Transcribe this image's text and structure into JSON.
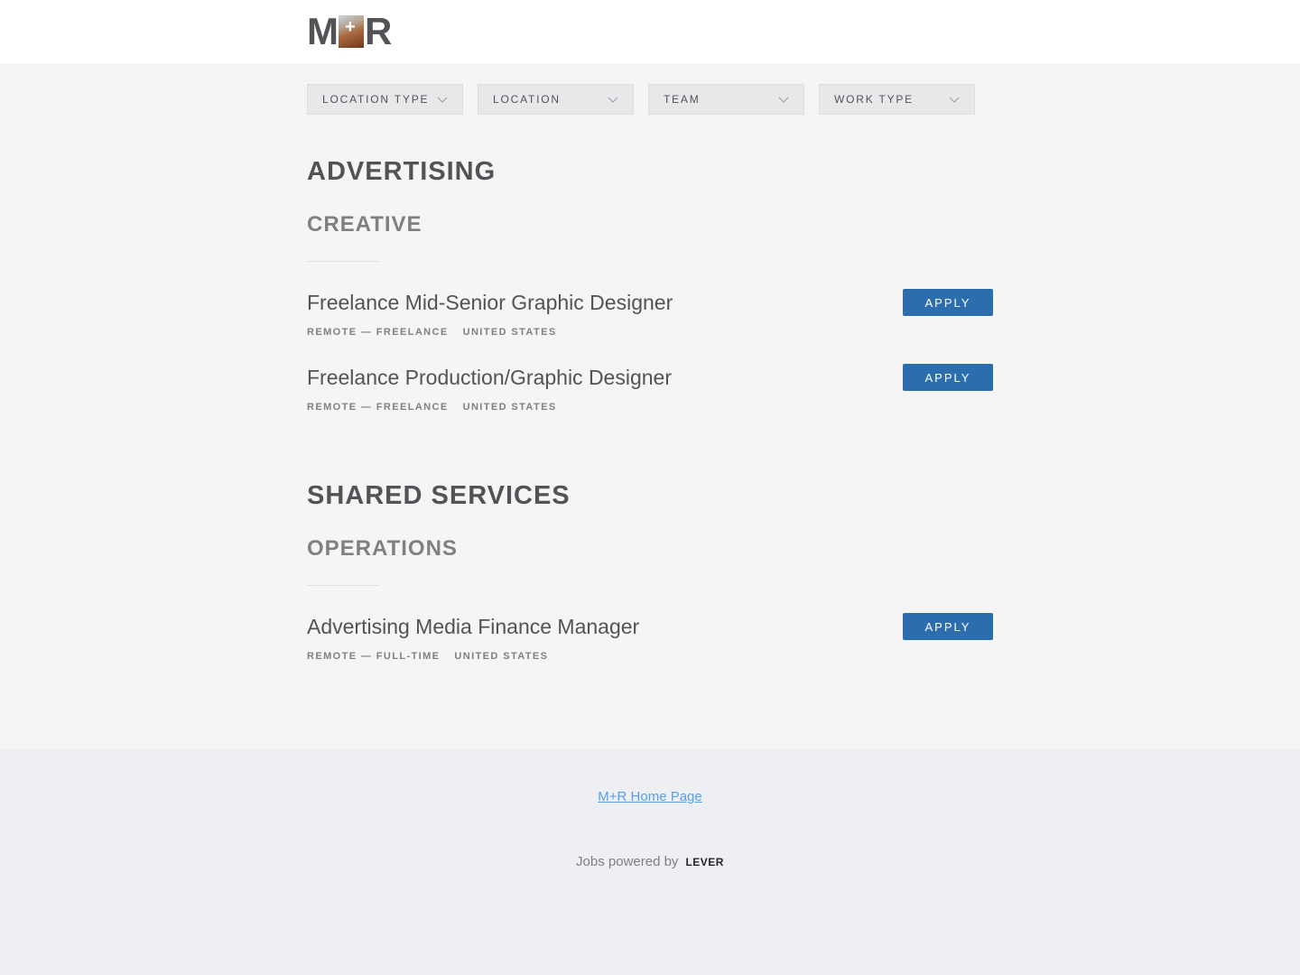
{
  "logo": {
    "letter_left": "M",
    "plus": "+",
    "letter_right": "R"
  },
  "filters": [
    {
      "label": "LOCATION TYPE",
      "icon": "chevron-down-icon"
    },
    {
      "label": "LOCATION",
      "icon": "chevron-down-icon"
    },
    {
      "label": "TEAM",
      "icon": "chevron-down-icon"
    },
    {
      "label": "WORK TYPE",
      "icon": "chevron-down-icon"
    }
  ],
  "departments": [
    {
      "title": "ADVERTISING",
      "team": "CREATIVE",
      "postings": [
        {
          "title": "Freelance Mid-Senior Graphic Designer",
          "commitment": "REMOTE — FREELANCE",
          "location": "UNITED STATES",
          "apply": "APPLY"
        },
        {
          "title": "Freelance Production/Graphic Designer",
          "commitment": "REMOTE — FREELANCE",
          "location": "UNITED STATES",
          "apply": "APPLY"
        }
      ]
    },
    {
      "title": "SHARED SERVICES",
      "team": "OPERATIONS",
      "postings": [
        {
          "title": "Advertising Media Finance Manager",
          "commitment": "REMOTE — FULL-TIME",
          "location": "UNITED STATES",
          "apply": "APPLY"
        }
      ]
    }
  ],
  "footer": {
    "home_link": "M+R Home Page",
    "powered_by": "Jobs powered by",
    "lever": "LEVER"
  },
  "colors": {
    "apply_button": "#2b6dad",
    "link": "#579eee",
    "text": "#515357",
    "muted": "#808080"
  }
}
